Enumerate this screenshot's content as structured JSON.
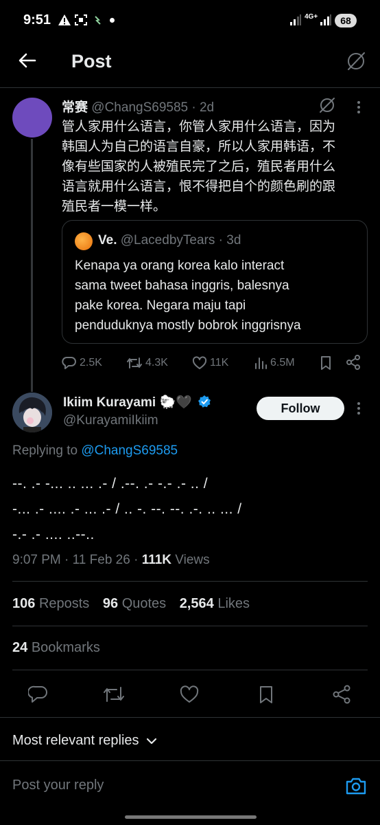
{
  "status_bar": {
    "time": "9:51",
    "network": "4G+",
    "battery": "68"
  },
  "header": {
    "title": "Post"
  },
  "parent_tweet": {
    "display_name": "常赛",
    "handle": "@ChangS69585",
    "time": "· 2d",
    "lines": [
      "管人家用什么语言，你管人家用什么语言，因为",
      "韩国人为自己的语言自豪，所以人家用韩语，不",
      "像有些国家的人被殖民完了之后，殖民者用什么",
      "语言就用什么语言，恨不得把自个的颜色刷的跟",
      "殖民者一模一样。"
    ],
    "quote": {
      "display_name": "Ve.",
      "handle": "@LacedbyTears",
      "time": "· 3d",
      "lines": [
        "Kenapa ya orang korea kalo interact",
        "sama tweet bahasa inggris, balesnya",
        "pake korea. Negara maju tapi",
        "penduduknya mostly bobrok inggrisnya"
      ]
    },
    "stats": {
      "replies": "2.5K",
      "reposts": "4.3K",
      "likes": "11K",
      "views": "6.5M"
    }
  },
  "main_tweet": {
    "display_name": "Ikiim Kurayami 🐑🖤",
    "handle": "@KurayamiIkiim",
    "follow_label": "Follow",
    "replying_prefix": "Replying to",
    "replying_to": "@ChangS69585",
    "lines": [
      "--. .- -... .. ... .- / .--. .- -.- .- .. /",
      "-... .- .... .- ... .- / .. -. --. --. .-. .. ... /",
      "-.- .- .... ..--.."
    ],
    "time": "9:07 PM · 11 Feb 26 ·",
    "views_count": "111K",
    "views_label": "Views",
    "reposts_count": "106",
    "reposts_label": "Reposts",
    "quotes_count": "96",
    "quotes_label": "Quotes",
    "likes_count": "2,564",
    "likes_label": "Likes",
    "bookmarks_count": "24",
    "bookmarks_label": "Bookmarks"
  },
  "replies_sort": {
    "label": "Most relevant replies"
  },
  "composer": {
    "placeholder": "Post your reply"
  },
  "colors": {
    "accent": "#1d9bf0",
    "background": "#000000",
    "avatar_parent": "#6e4bbd"
  }
}
